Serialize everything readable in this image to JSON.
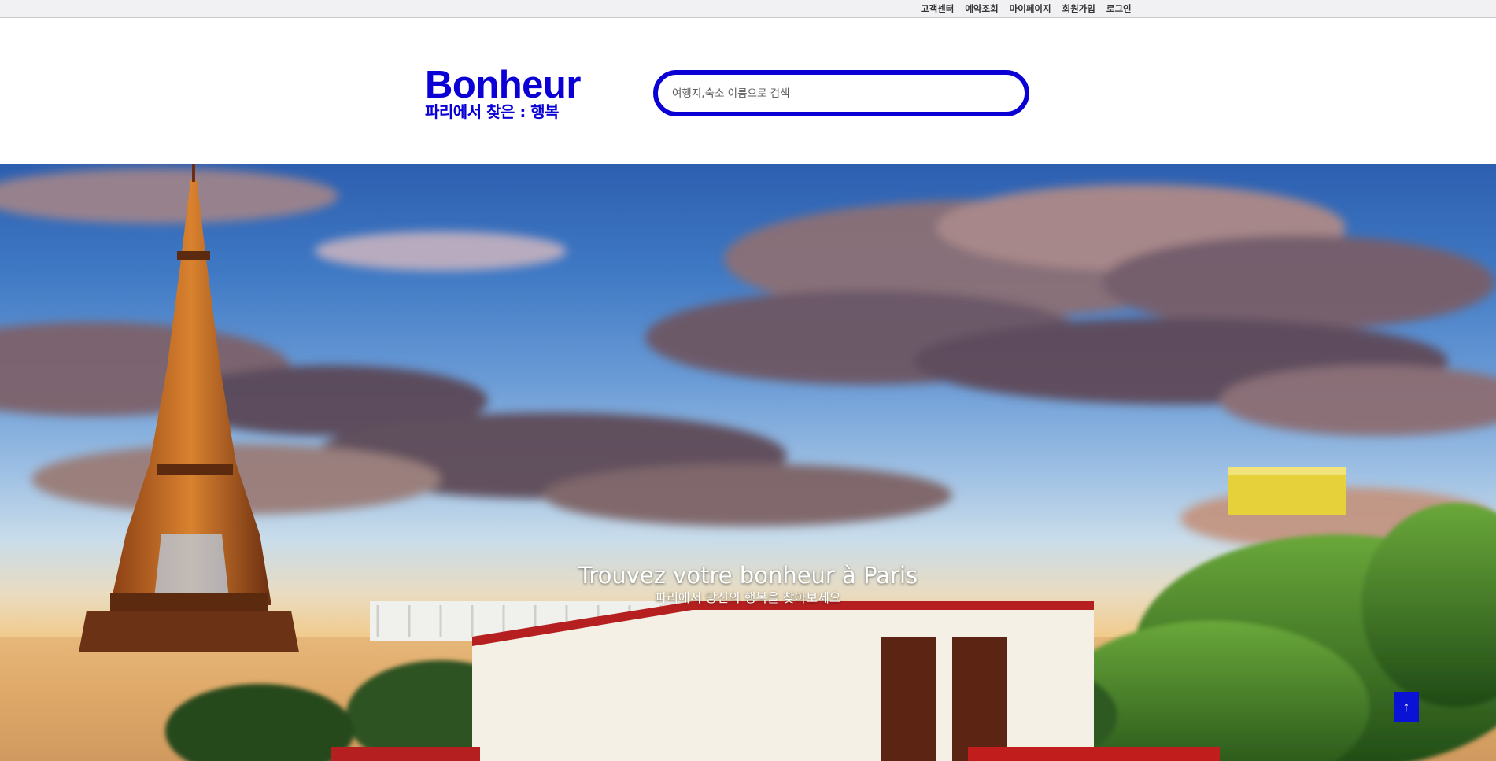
{
  "topbar": {
    "links": [
      {
        "label": "고객센터"
      },
      {
        "label": "예약조회"
      },
      {
        "label": "마이페이지"
      },
      {
        "label": "회원가입"
      },
      {
        "label": "로그인"
      }
    ]
  },
  "header": {
    "logo_title": "Bonheur",
    "logo_subtitle": "파리에서 찾은 : 행복",
    "search": {
      "placeholder": "여행지,숙소 이름으로 검색",
      "value": ""
    }
  },
  "hero": {
    "title": "Trouvez votre bonheur à Paris",
    "subtitle": "파리에서 당신의 행복을 찾아보세요"
  },
  "scroll_top": {
    "icon": "arrow-up-icon",
    "glyph": "↑"
  },
  "colors": {
    "brand": "#0a00d6",
    "topbar_bg": "#f1f1f3",
    "scroll_button": "#0a12d6"
  }
}
